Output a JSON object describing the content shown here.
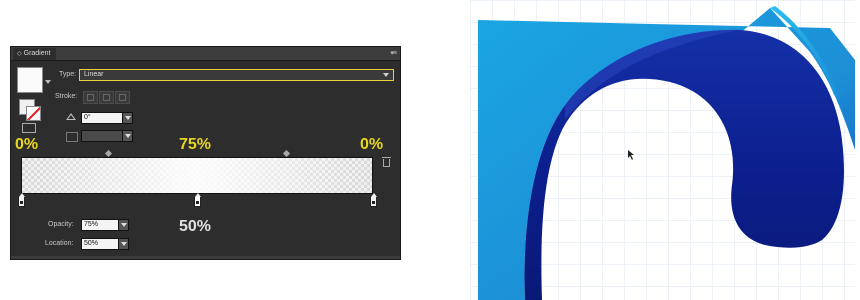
{
  "panel": {
    "tab_label": "Gradient",
    "type_label": "Type:",
    "type_value": "Linear",
    "stroke_label": "Stroke:",
    "angle_value": "0°",
    "aspect_value": "",
    "opacity_label": "Opacity:",
    "opacity_value": "75%",
    "location_label": "Location:",
    "location_value": "50%"
  },
  "overlay": {
    "left_pct": "0%",
    "mid_pct": "75%",
    "right_pct": "0%",
    "location_pct": "50%"
  },
  "colors": {
    "accent_yellow": "#e8d61e",
    "panel_bg": "#2d2d2d",
    "art_blue_dark": "#0b1f8c",
    "art_blue_light": "#1fa6e0"
  },
  "icons": [
    "chevron-icon",
    "panel-menu-icon",
    "angle-icon",
    "aspect-ratio-icon",
    "trash-icon",
    "gradient-stop-icon",
    "cursor-icon"
  ]
}
